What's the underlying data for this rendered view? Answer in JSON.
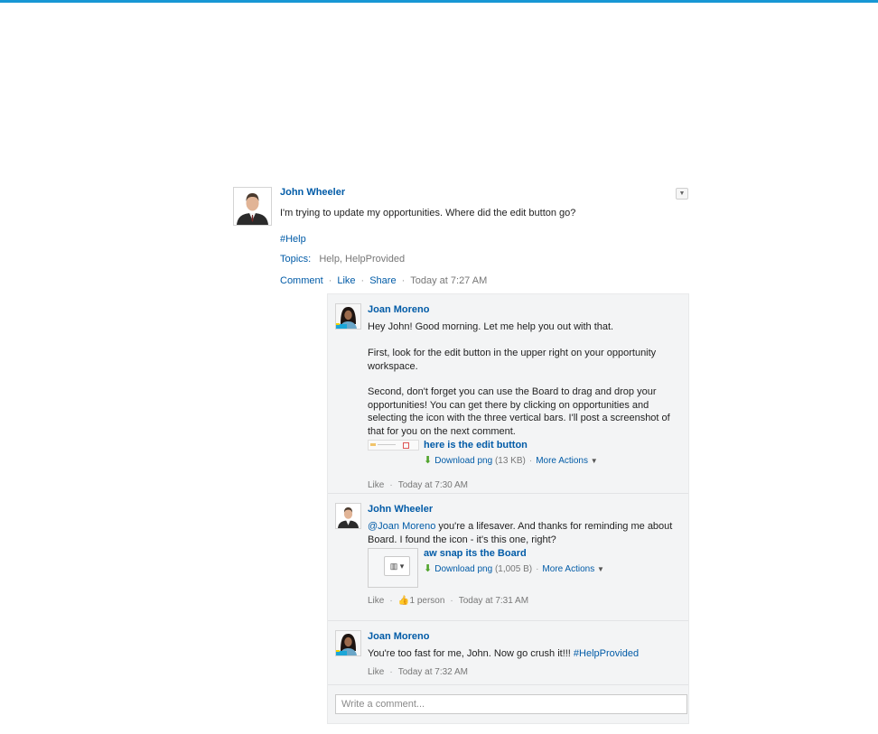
{
  "post": {
    "author": "John Wheeler",
    "text": "I'm trying to update my opportunities. Where did the edit button go?",
    "hashtag": "#Help",
    "topics_label": "Topics:",
    "topics": "Help, HelpProvided",
    "actions": {
      "comment": "Comment",
      "like": "Like",
      "share": "Share",
      "timestamp": "Today at 7:27 AM"
    },
    "menu_icon": "chevron-down-icon"
  },
  "comments": [
    {
      "author": "Joan Moreno",
      "paragraphs": [
        "Hey John! Good morning. Let me help you out with that.",
        "First, look for the edit button in the upper right on your opportunity workspace.",
        "Second, don't forget you can use the Board to drag and drop your opportunities! You can get there by clicking on opportunities and selecting the icon with the three vertical bars. I'll post a screenshot of that for you on the next comment."
      ],
      "attachment": {
        "name": "here is the edit button",
        "download": "Download png",
        "size": "(13 KB)",
        "more": "More Actions"
      },
      "like": "Like",
      "timestamp": "Today at 7:30 AM"
    },
    {
      "author": "John Wheeler",
      "mention": "@Joan Moreno",
      "text": " you're a lifesaver. And thanks for reminding me about Board. I found the icon - it's this one, right?",
      "attachment": {
        "name": "aw snap its the Board",
        "download": "Download png",
        "size": "(1,005 B)",
        "more": "More Actions"
      },
      "like": "Like",
      "likes_count": "1 person",
      "timestamp": "Today at 7:31 AM"
    },
    {
      "author": "Joan Moreno",
      "text": "You're too fast for me, John. Now go crush it!!! ",
      "hashtag": "#HelpProvided",
      "like": "Like",
      "timestamp": "Today at 7:32 AM"
    }
  ],
  "comment_box": {
    "placeholder": "Write a comment..."
  },
  "colors": {
    "accent_bar": "#1797d4",
    "link": "#015ba7",
    "download_icon": "#4fa32a"
  }
}
